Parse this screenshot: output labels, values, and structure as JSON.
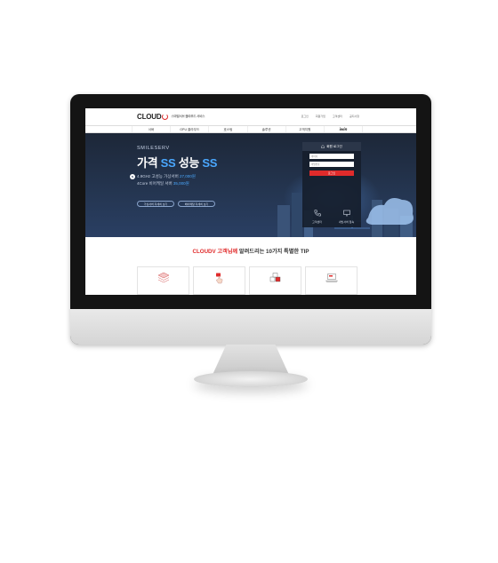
{
  "site": {
    "logo_text": "CLOUD",
    "tagline": "스마일서브 클라우드 서비스",
    "top_links": [
      "로그인",
      "회원가입",
      "고객센터",
      "공지사항"
    ],
    "nav": [
      "서버",
      "GPU 클라우드",
      "호스팅",
      "솔루션",
      "고객지원",
      "iwin"
    ]
  },
  "hero": {
    "brand": "SMILESERV",
    "headline_prefix": "가격",
    "headline_ss1": "SS",
    "headline_middle": "성능",
    "headline_ss2": "SS",
    "spec1_text": "4.9GHz 고성능 가상서버",
    "spec1_price": "27,000원",
    "spec2_text": "4Core 비어케일 서버",
    "spec2_price": "35,000원",
    "button1": "가상서버 자세히 보기",
    "button2": "베어메탈 자세히 보기"
  },
  "login": {
    "title": "회원 로그인",
    "id_placeholder": "아이디",
    "pw_placeholder": "비밀번호",
    "button": "로그인",
    "cell1": "고객센터",
    "cell2": "내빌서버 접속"
  },
  "tips": {
    "title_red": "CLOUDV 고객님께",
    "title_rest": "알려드리는 10가지 특별한 TIP"
  },
  "colors": {
    "accent_red": "#e02b2b",
    "accent_blue": "#4aa8ff",
    "hero_bg": "#243550"
  }
}
